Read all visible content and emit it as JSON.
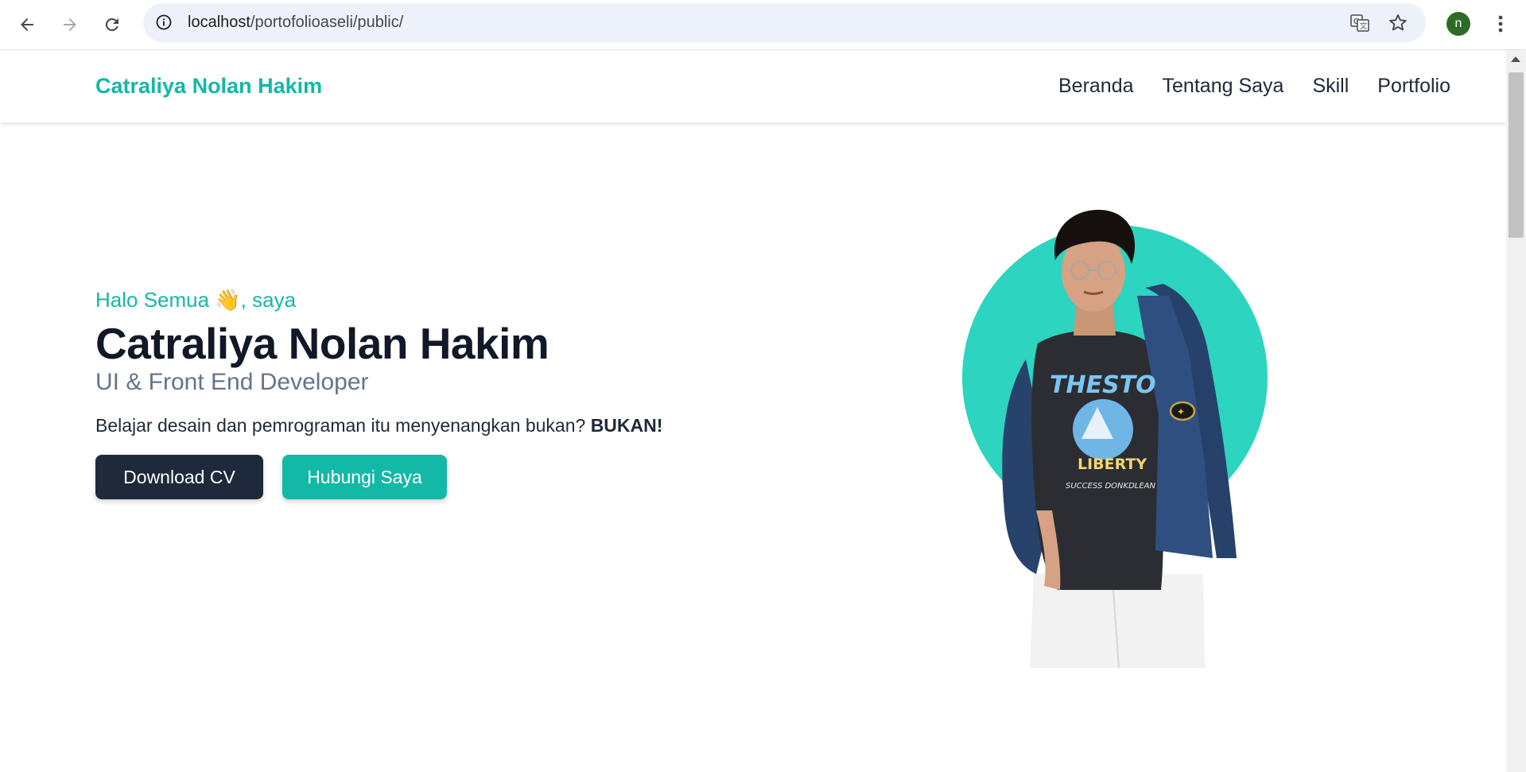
{
  "browser": {
    "url_host": "localhost",
    "url_path": "/portofolioaseli/public/",
    "profile_initial": "n"
  },
  "site": {
    "brand": "Catraliya Nolan Hakim",
    "menu": [
      {
        "label": "Beranda"
      },
      {
        "label": "Tentang Saya"
      },
      {
        "label": "Skill"
      },
      {
        "label": "Portfolio"
      }
    ]
  },
  "hero": {
    "greeting": "Halo Semua 👋, saya",
    "name": "Catraliya Nolan Hakim",
    "role": "UI & Front End Developer",
    "tagline": "Belajar desain dan pemrograman itu menyenangkan bukan?",
    "tagline_emphasis": "BUKAN!",
    "buttons": {
      "download_cv": "Download CV",
      "contact": "Hubungi Saya"
    },
    "shirt_text_top": "THESTO",
    "shirt_text_mid": "LIBERTY",
    "shirt_text_bottom": "SUCCESS DONKDLEAN"
  },
  "colors": {
    "accent": "#14b8a6",
    "accent_circle": "#2dd4bf",
    "dark_button": "#1e293b",
    "heading": "#111827"
  }
}
